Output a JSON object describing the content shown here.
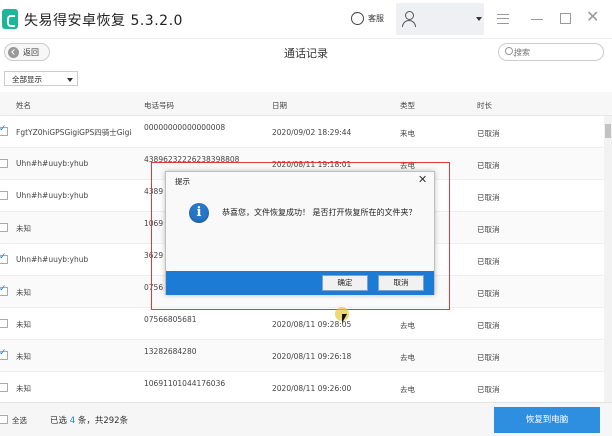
{
  "app": {
    "title": "失易得安卓恢复  5.3.2.0",
    "cs_label": "客服"
  },
  "toolbar": {
    "back_label": "返回",
    "page_title": "通话记录",
    "search_placeholder": "搜索"
  },
  "filter": {
    "selected": "全部显示"
  },
  "columns": [
    "姓名",
    "电话号码",
    "日期",
    "类型",
    "时长"
  ],
  "rows": [
    {
      "checked": true,
      "name": "FgtYZ0hiGPSGigiGPS四骑士Gigi",
      "phone": "00000000000000008",
      "date": "2020/09/02 18:29:44",
      "type": "来电",
      "duration": "已取消"
    },
    {
      "checked": false,
      "name": "Uhn#h#uuyb:yhub",
      "phone": "43896232226238398808",
      "date": "2020/08/11 19:18:01",
      "type": "去电",
      "duration": "已取消"
    },
    {
      "checked": false,
      "name": "Uhn#h#uuyb:yhub",
      "phone": "4389",
      "date": "",
      "type": "",
      "duration": "已取消"
    },
    {
      "checked": false,
      "name": "未知",
      "phone": "1069",
      "date": "",
      "type": "",
      "duration": "已取消"
    },
    {
      "checked": true,
      "name": "Uhn#h#uuyb:yhub",
      "phone": "3629",
      "date": "",
      "type": "",
      "duration": "已取消"
    },
    {
      "checked": true,
      "name": "未知",
      "phone": "0756",
      "date": "",
      "type": "",
      "duration": "已取消"
    },
    {
      "checked": false,
      "name": "未知",
      "phone": "07566805681",
      "date": "2020/08/11 09:28:05",
      "type": "去电",
      "duration": "已取消"
    },
    {
      "checked": true,
      "name": "未知",
      "phone": "13282684280",
      "date": "2020/08/11 09:26:18",
      "type": "去电",
      "duration": "已取消"
    },
    {
      "checked": false,
      "name": "未知",
      "phone": "10691101044176036",
      "date": "2020/08/11 09:26:00",
      "type": "去电",
      "duration": "已取消"
    }
  ],
  "footer": {
    "select_all": "全选",
    "selected_prefix": "已选",
    "selected_count": "4",
    "selected_suffix": "条，共292条",
    "recover_button": "恢复到电脑"
  },
  "dialog": {
    "title": "提示",
    "message": "恭喜您，文件恢复成功！ 是否打开恢复所在的文件夹？",
    "ok": "确定",
    "cancel": "取消"
  },
  "colors": {
    "brand": "#1fb59a",
    "accent": "#2e8fe0",
    "dialog_bar": "#1c7bd4",
    "highlight_outline": "#e0393a"
  }
}
